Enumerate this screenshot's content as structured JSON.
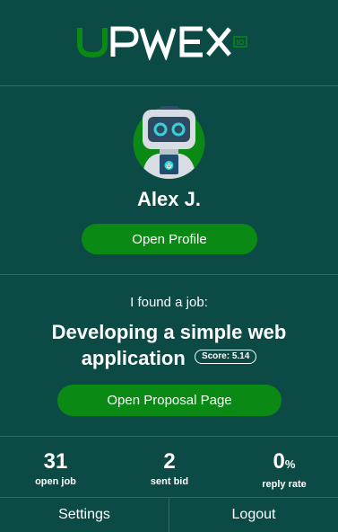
{
  "brand": {
    "logo_text": "UPWEX",
    "logo_suffix": "IO",
    "accent_color": "#0a8a15",
    "background_color": "#0c4a45"
  },
  "profile": {
    "avatar_icon": "robot-avatar-icon",
    "name": "Alex J.",
    "open_profile_label": "Open Profile"
  },
  "job": {
    "intro": "I found a job:",
    "title": "Developing a simple web application",
    "score_label": "Score: 5.14",
    "open_proposal_label": "Open Proposal Page"
  },
  "stats": {
    "open_job": {
      "value": "31",
      "label": "open job"
    },
    "sent_bid": {
      "value": "2",
      "label": "sent bid"
    },
    "reply_rate": {
      "value": "0",
      "unit": "%",
      "label": "reply rate"
    }
  },
  "footer": {
    "settings_label": "Settings",
    "logout_label": "Logout"
  }
}
